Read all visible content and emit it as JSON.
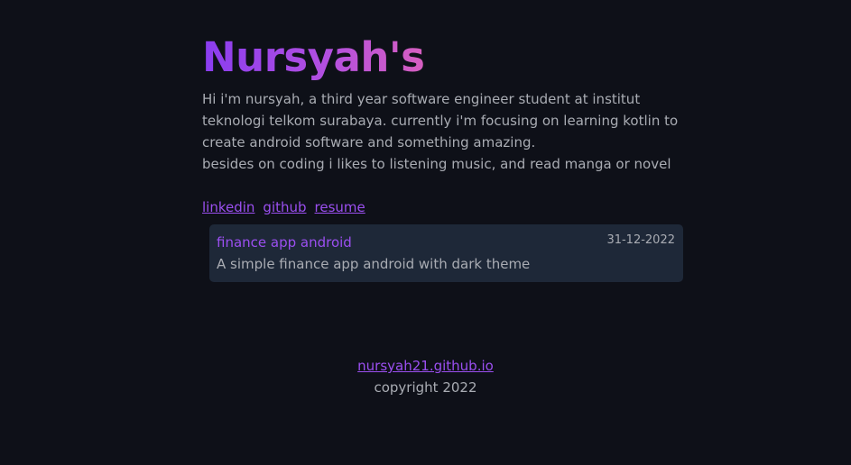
{
  "header": {
    "title": "Nursyah's"
  },
  "bio": {
    "line1": "Hi i'm nursyah, a third year software engineer student at institut teknologi telkom surabaya. currently i'm focusing on learning kotlin to create android software and something amazing.",
    "line2": "besides on coding i likes to listening music, and read manga or novel"
  },
  "links": {
    "linkedin": "linkedin",
    "github": "github",
    "resume": "resume"
  },
  "projects": [
    {
      "title": "finance app android",
      "date": "31-12-2022",
      "description": "A simple finance app android with dark theme"
    }
  ],
  "footer": {
    "site": "nursyah21.github.io",
    "copyright": "copyright 2022"
  },
  "colors": {
    "background": "#0e1018",
    "card": "#1e2838",
    "accent": "#9b4ff0",
    "text": "#a9acb3"
  }
}
